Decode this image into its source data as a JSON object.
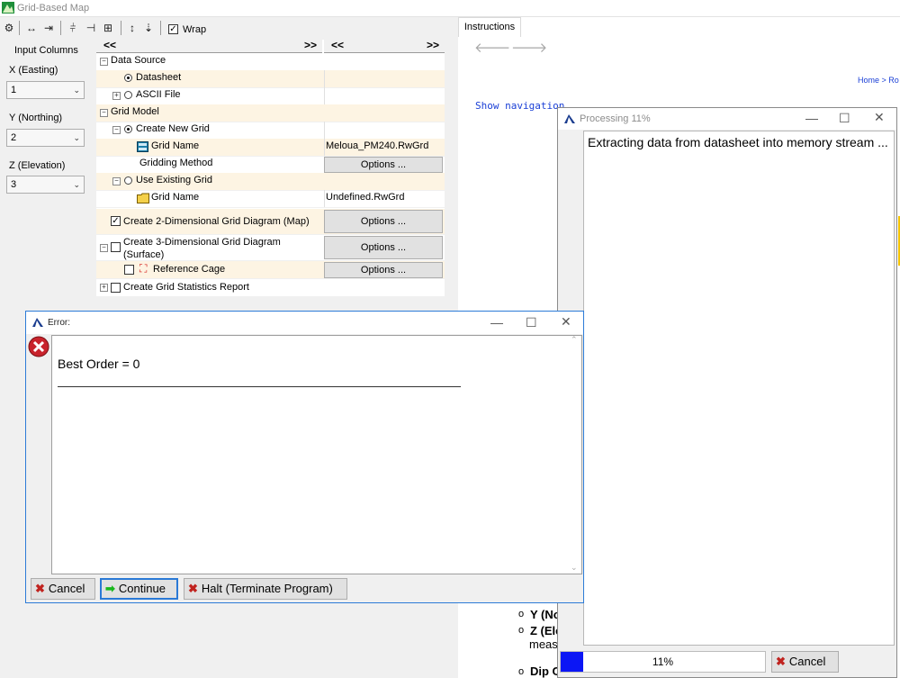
{
  "app": {
    "title": "Grid-Based Map",
    "toolbar": {
      "wrap_label": "Wrap",
      "wrap_checked": true
    }
  },
  "left_panel": {
    "heading": "Input Columns",
    "fields": [
      {
        "label": "X (Easting)",
        "value": "1"
      },
      {
        "label": "Y (Northing)",
        "value": "2"
      },
      {
        "label": "Z (Elevation)",
        "value": "3"
      }
    ]
  },
  "grid": {
    "header_left": "<<      >>",
    "header_right": "<<      >>",
    "rows": {
      "data_source": "Data Source",
      "datasheet": "Datasheet",
      "ascii_file": "ASCII File",
      "grid_model": "Grid Model",
      "create_new_grid": "Create New Grid",
      "grid_name_new": "Grid Name",
      "grid_name_new_value": "Meloua_PM240.RwGrd",
      "gridding_method": "Gridding Method",
      "options_label": "Options ...",
      "use_existing_grid": "Use Existing Grid",
      "grid_name_existing": "Grid Name",
      "grid_name_existing_value": "Undefined.RwGrd",
      "create_2d": "Create 2-Dimensional Grid Diagram (Map)",
      "create_3d_line1": "Create 3-Dimensional Grid Diagram",
      "create_3d_line2": "(Surface)",
      "reference_cage": "Reference Cage",
      "create_stats": "Create Grid Statistics Report"
    }
  },
  "instructions": {
    "tab": "Instructions",
    "show_navigation": "Show navigation",
    "home_link": "Home > Ro",
    "bullets": [
      "Y (No",
      "Z (Ele",
      "Dip C"
    ],
    "meas": "meas"
  },
  "processing": {
    "title": "Processing 11%",
    "message": "Extracting data from datasheet into memory stream ...",
    "progress_percent": 11,
    "progress_label": "11%",
    "cancel": "Cancel"
  },
  "error_dialog": {
    "title": "Error:",
    "message": "Best Order = 0",
    "buttons": {
      "cancel": "Cancel",
      "continue": "Continue",
      "halt": "Halt (Terminate Program)"
    }
  },
  "colors": {
    "progress_fill": "#0b16f5",
    "accent": "#2a79d6",
    "row_highlight": "#fdf4e3",
    "link": "#1a3fd6"
  }
}
